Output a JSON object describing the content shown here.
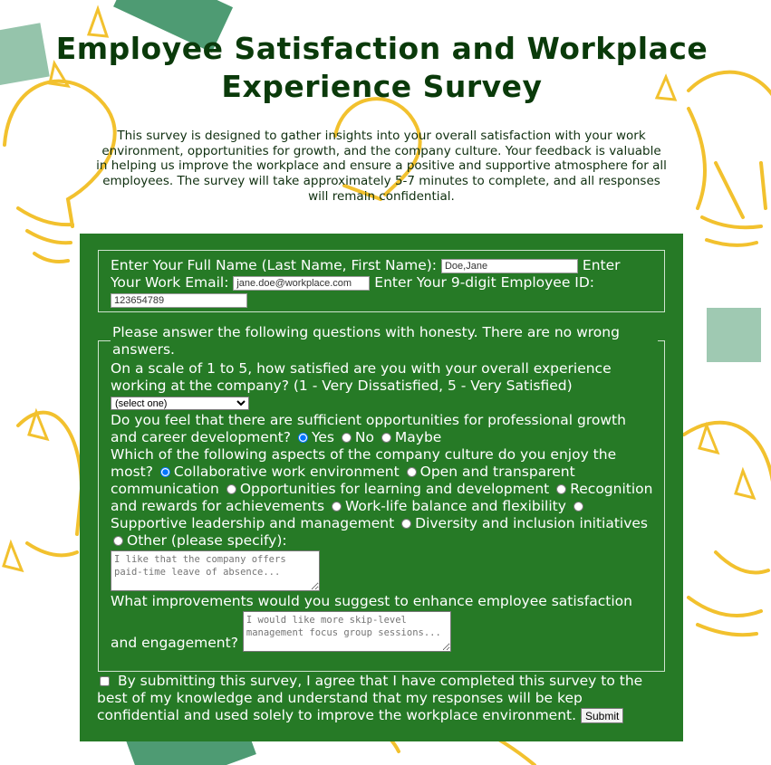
{
  "title": "Employee Satisfaction and Workplace Experience Survey",
  "intro": "This survey is designed to gather insights into your overall satisfaction with your work environment, opportunities for growth, and the company culture. Your feedback is valuable in helping us improve the workplace and ensure a positive and supportive atmosphere for all employees. The survey will take approximately 5-7 minutes to complete, and all responses will remain confidential.",
  "colors": {
    "form_bg": "#267a26",
    "title": "#0a3a0a",
    "bulb_yellow": "#f2c12e",
    "bg_green": "#2f8a5a"
  },
  "identity": {
    "name_label": "Enter Your Full Name (Last Name, First Name):",
    "name_value": "Doe,Jane",
    "email_label": "Enter Your Work Email:",
    "email_value": "jane.doe@workplace.com",
    "id_label": "Enter Your 9-digit Employee ID:",
    "id_value": "123654789"
  },
  "questions": {
    "legend": "Please answer the following questions with honesty. There are no wrong answers.",
    "q1": {
      "label": "On a scale of 1 to 5, how satisfied are you with your overall experience working at the company? (1 - Very Dissatisfied, 5 - Very Satisfied)",
      "selected": "(select one)"
    },
    "q2": {
      "label": "Do you feel that there are sufficient opportunities for professional growth and career development?",
      "options": [
        "Yes",
        "No",
        "Maybe"
      ],
      "selected": "Yes"
    },
    "q3": {
      "label": "Which of the following aspects of the company culture do you enjoy the most?",
      "options": [
        "Collaborative work environment",
        "Open and transparent communication",
        "Opportunities for learning and development",
        "Recognition and rewards for achievements",
        "Work-life balance and flexibility",
        "Supportive leadership and management",
        "Diversity and inclusion initiatives",
        "Other (please specify):"
      ],
      "selected": "Collaborative work environment",
      "other_placeholder": "I like that the company offers paid-time leave of absence..."
    },
    "q4": {
      "label": "What improvements would you suggest to enhance employee satisfaction and engagement?",
      "placeholder": "I would like more skip-level management focus group sessions..."
    }
  },
  "agreement": "By submitting this survey, I agree that I have completed this survey to the best of my knowledge and understand that my responses will be kep confidential and used solely to improve the workplace environment.",
  "submit_label": "Submit"
}
